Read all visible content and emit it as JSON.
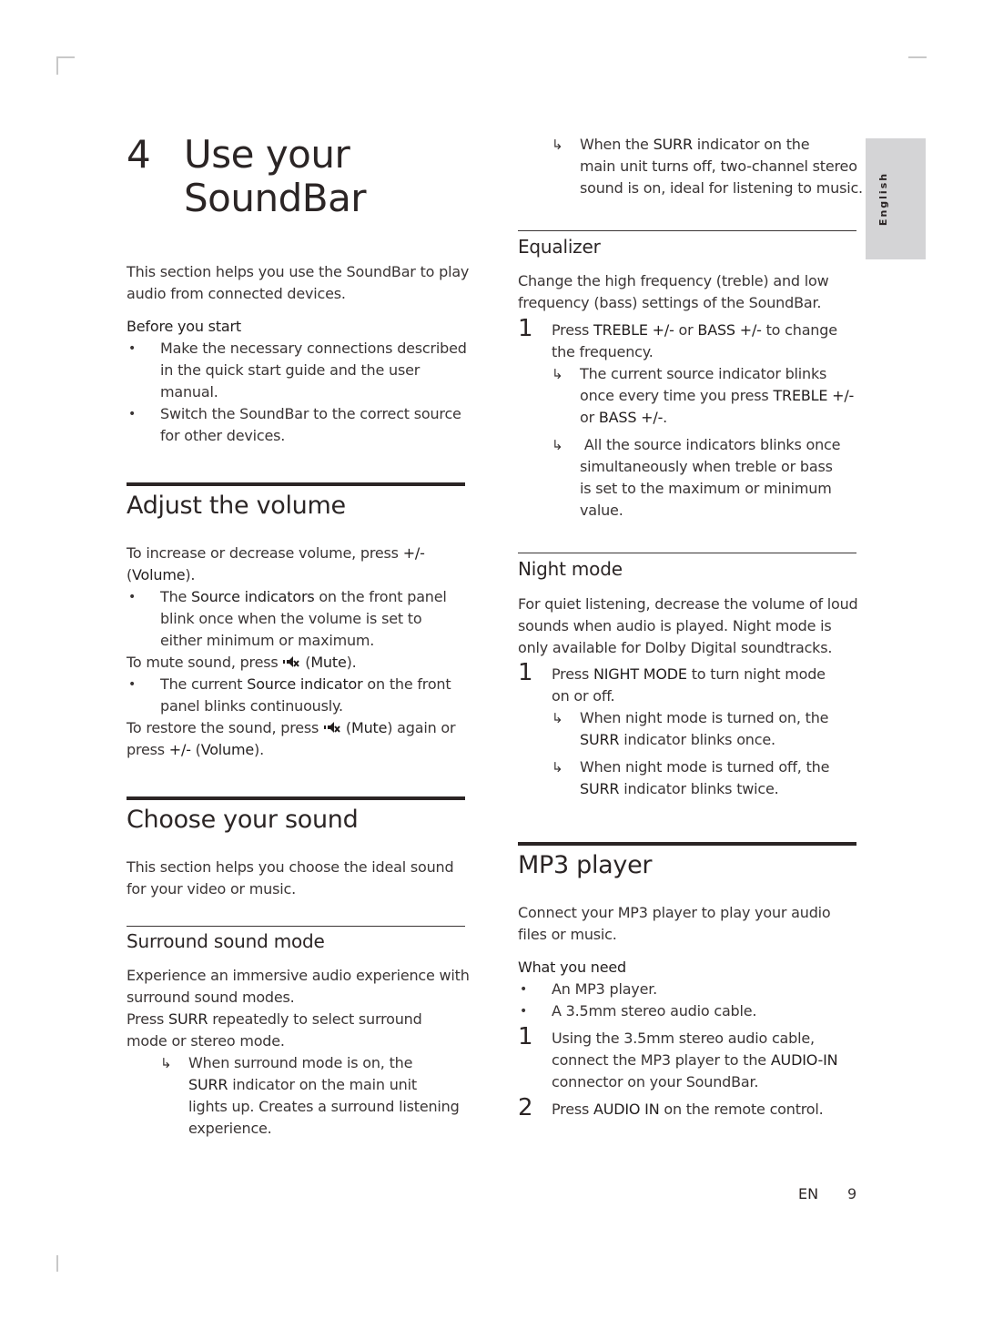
{
  "chapter": {
    "number": "4",
    "title_line1": "Use your",
    "title_line2": "SoundBar",
    "intro": [
      "This section helps you use the SoundBar to play",
      "audio from connected devices."
    ],
    "before_label": "Before you start",
    "before_bullets": [
      [
        "Make the necessary connections described",
        "in the quick start guide and the user",
        "manual."
      ],
      [
        "Switch the SoundBar to the correct source",
        "for other devices."
      ]
    ]
  },
  "adjust_volume": {
    "heading": "Adjust the volume",
    "p1_a": "To increase or decrease volume, press ",
    "p1_b": "+/-",
    "p1_c": "(",
    "p1_d": "Volume",
    "p1_e": ").",
    "b1_a": "The ",
    "b1_b": "Source indicators",
    "b1_c": " on the front panel",
    "b1_l2": "blink once when the volume is set to",
    "b1_l3": "either minimum or maximum.",
    "mute_a": "To mute sound, press ",
    "mute_b": " (",
    "mute_c": "Mute",
    "mute_d": ").",
    "b2_a": "The current ",
    "b2_b": "Source indicator",
    "b2_c": " on the front",
    "b2_l2": "panel blinks continuously.",
    "restore_a": "To restore the sound, press ",
    "restore_b": " (",
    "restore_c": "Mute",
    "restore_d": ") again or",
    "restore_l2_a": "press ",
    "restore_l2_b": "+/-",
    "restore_l2_c": " (",
    "restore_l2_d": "Volume",
    "restore_l2_e": ")."
  },
  "choose_sound": {
    "heading": "Choose your sound",
    "intro": [
      "This section helps you choose the ideal sound",
      "for your video or music."
    ]
  },
  "surround": {
    "heading": "Surround sound mode",
    "p1": [
      "Experience an immersive audio experience with",
      "surround sound modes."
    ],
    "p2_a": "Press ",
    "p2_b": "SURR",
    "p2_c": " repeatedly to select surround",
    "p2_l2": "mode or stereo mode.",
    "r1_l1": "When surround mode is on, the",
    "r1_l2_a": "SURR",
    "r1_l2_b": " indicator on the main unit",
    "r1_l3": "lights up. Creates a surround listening",
    "r1_l4": "experience.",
    "r2_l1_a": "When the ",
    "r2_l1_b": "SURR",
    "r2_l1_c": " indicator on the",
    "r2_l2": "main unit turns off, two-channel stereo",
    "r2_l3": "sound is on, ideal for listening to music."
  },
  "equalizer": {
    "heading": "Equalizer",
    "intro": [
      "Change the high frequency (treble) and low",
      "frequency (bass) settings of the SoundBar."
    ],
    "step1_num": "1",
    "step1_a": "Press ",
    "step1_b": "TREBLE +/-",
    "step1_c": " or ",
    "step1_d": "BASS +/-",
    "step1_e": " to change",
    "step1_l2": "the frequency.",
    "r1_l1": "The current source indicator blinks",
    "r1_l2_a": "once every time you press ",
    "r1_l2_b": "TREBLE +/-",
    "r1_l3_a": "or ",
    "r1_l3_b": "BASS +/-",
    "r1_l3_c": ".",
    "r2": [
      " All the source indicators blinks once",
      "simultaneously when treble or bass",
      "is set to the maximum or minimum",
      "value."
    ]
  },
  "night_mode": {
    "heading": "Night mode",
    "intro": [
      "For quiet listening, decrease the volume of loud",
      "sounds when audio is played. Night mode is",
      "only available for Dolby Digital soundtracks."
    ],
    "step1_num": "1",
    "step1_a": "Press ",
    "step1_b": "NIGHT MODE",
    "step1_c": " to turn night mode",
    "step1_l2": "on or off.",
    "r1_l1": "When night mode is turned on, the",
    "r1_l2_a": "SURR",
    "r1_l2_b": " indicator blinks once.",
    "r2_l1": "When night mode is turned off, the",
    "r2_l2_a": "SURR",
    "r2_l2_b": " indicator blinks twice."
  },
  "mp3": {
    "heading": "MP3 player",
    "intro": [
      "Connect your MP3 player to play your audio",
      "files or music."
    ],
    "need_label": "What you need",
    "need_bullets": [
      "An MP3 player.",
      "A 3.5mm stereo audio cable."
    ],
    "step1_num": "1",
    "step1_l1": "Using the 3.5mm stereo audio cable,",
    "step1_l2_a": "connect the MP3 player to the ",
    "step1_l2_b": "AUDIO-IN",
    "step1_l3": "connector on your SoundBar.",
    "step2_num": "2",
    "step2_a": "Press ",
    "step2_b": "AUDIO IN",
    "step2_c": " on the remote control."
  },
  "sidebar": {
    "language": "English"
  },
  "footer": {
    "lang_code": "EN",
    "page_number": "9"
  },
  "glyphs": {
    "bullet": "•",
    "result_arrow": "↳"
  },
  "icons": {
    "mute": "mute-icon"
  }
}
